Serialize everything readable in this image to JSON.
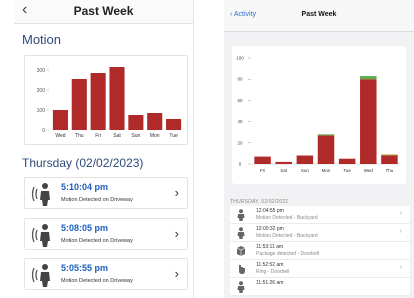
{
  "left": {
    "title": "Past Week",
    "section_title": "Motion",
    "day_heading": "Thursday (02/02/2023)",
    "events": [
      {
        "time": "5:10:04 pm",
        "desc": "Motion Detected on Driveway"
      },
      {
        "time": "5:08:05 pm",
        "desc": "Motion Detected on Driveway"
      },
      {
        "time": "5:05:55 pm",
        "desc": "Motion Detected on Driveway"
      }
    ]
  },
  "right": {
    "back_label": "Activity",
    "title": "Past Week",
    "section_label": "THURSDAY, 02/02/2022",
    "items": [
      {
        "time": "12:04:55 pm",
        "desc": "Motion Detected - Backyard",
        "icon": "person-icon"
      },
      {
        "time": "12:00:32 pm",
        "desc": "Motion Detected - Backyard",
        "icon": "person-icon"
      },
      {
        "time": "11:53:11 am",
        "desc": "Package detected - Doorbell",
        "icon": "package-icon"
      },
      {
        "time": "11:52:52 am",
        "desc": "Ring - Doorbell",
        "icon": "ring-icon"
      },
      {
        "time": "11:51:26 am",
        "desc": "",
        "icon": "person-icon"
      }
    ]
  },
  "colors": {
    "bar_red": "#b12a2a",
    "bar_green": "#5fae4e",
    "bar_olive": "#b8a040",
    "accent_blue": "#2f4a7a",
    "link_blue": "#1a5fbf"
  },
  "chart_data": [
    {
      "type": "bar",
      "categories": [
        "Wed",
        "Thu",
        "Fri",
        "Sat",
        "Sun",
        "Mon",
        "Tue"
      ],
      "values": [
        100,
        255,
        285,
        315,
        75,
        85,
        55
      ],
      "ylim": [
        0,
        330
      ],
      "yticks": [
        0,
        100,
        200,
        300
      ],
      "title": "",
      "xlabel": "",
      "ylabel": ""
    },
    {
      "type": "bar",
      "categories": [
        "Fri",
        "Sat",
        "Sun",
        "Mon",
        "Tue",
        "Wed",
        "Thu"
      ],
      "series": [
        {
          "values": [
            7,
            2,
            8,
            27,
            5,
            80,
            8
          ]
        },
        {
          "values": [
            0,
            0,
            0,
            1,
            0,
            3,
            1
          ]
        }
      ],
      "ylim": [
        0,
        100
      ],
      "yticks": [
        0,
        20,
        40,
        60,
        80,
        100
      ],
      "title": "",
      "xlabel": "",
      "ylabel": ""
    }
  ]
}
